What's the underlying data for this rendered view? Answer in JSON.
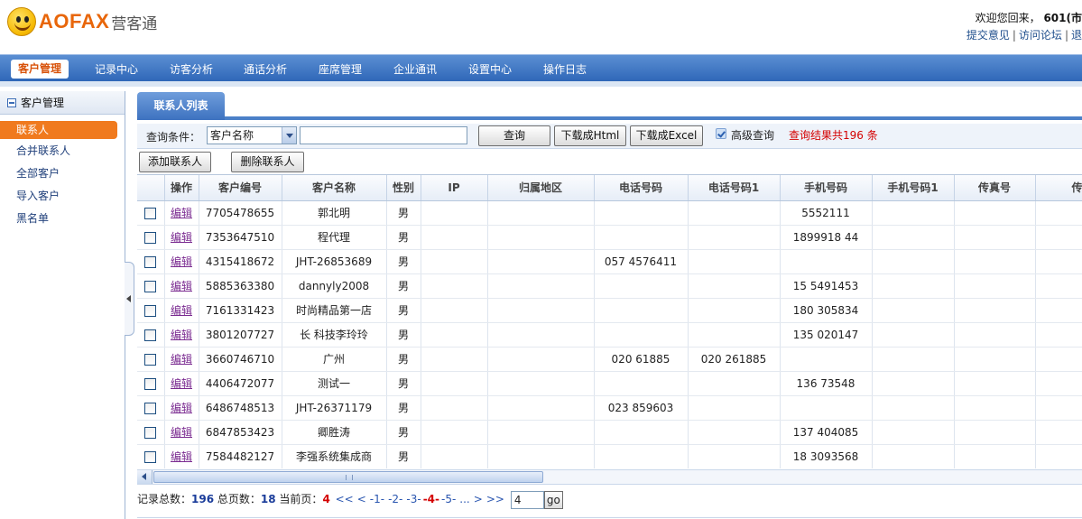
{
  "header": {
    "logo_text": "AOFAX",
    "logo_sub": "营客通",
    "welcome": "欢迎您回来，",
    "user": "601(市",
    "links": [
      "提交意见",
      "访问论坛",
      "退"
    ]
  },
  "nav": {
    "items": [
      "客户管理",
      "记录中心",
      "访客分析",
      "通话分析",
      "座席管理",
      "企业通讯",
      "设置中心",
      "操作日志"
    ],
    "active": "客户管理"
  },
  "sidebar": {
    "title": "客户管理",
    "items": [
      "联系人",
      "合并联系人",
      "全部客户",
      "导入客户",
      "黑名单"
    ]
  },
  "main": {
    "tab_label": "联系人列表",
    "query_label": "查询条件：",
    "query_field": "客户名称",
    "query_value": "",
    "query_button": "查询",
    "download_html": "下载成Html",
    "download_excel": "下载成Excel",
    "advanced_query": "高级查询",
    "result_prefix": "查询结果共",
    "result_count": "196",
    "result_suffix": " 条",
    "add_contact": "添加联系人",
    "delete_contact": "删除联系人"
  },
  "table": {
    "headers": [
      "操作",
      "客户编号",
      "客户名称",
      "性别",
      "IP",
      "归属地区",
      "电话号码",
      "电话号码1",
      "手机号码",
      "手机号码1",
      "传真号",
      "传真"
    ],
    "edit_label": "编辑",
    "rows": [
      {
        "id": "7705478655",
        "name": "郭北明",
        "gender": "男",
        "phone": "",
        "phone1": "",
        "mobile": "5552111"
      },
      {
        "id": "7353647510",
        "name": "程代理",
        "gender": "男",
        "phone": "",
        "phone1": "",
        "mobile": "1899918   44"
      },
      {
        "id": "4315418672",
        "name": "JHT-26853689",
        "gender": "男",
        "phone": "057   4576411",
        "phone1": "",
        "mobile": ""
      },
      {
        "id": "5885363380",
        "name": "dannyly2008",
        "gender": "男",
        "phone": "",
        "phone1": "",
        "mobile": "15   5491453"
      },
      {
        "id": "7161331423",
        "name": "时尚精品第一店",
        "gender": "男",
        "phone": "",
        "phone1": "",
        "mobile": "180   305834"
      },
      {
        "id": "3801207727",
        "name": "长   科技李玲玲",
        "gender": "男",
        "phone": "",
        "phone1": "",
        "mobile": "135   020147"
      },
      {
        "id": "3660746710",
        "name": "广州",
        "gender": "男",
        "phone": "020    61885",
        "phone1": "020   261885",
        "mobile": ""
      },
      {
        "id": "4406472077",
        "name": "测试一",
        "gender": "男",
        "phone": "",
        "phone1": "",
        "mobile": "136   73548"
      },
      {
        "id": "6486748513",
        "name": "JHT-26371179",
        "gender": "男",
        "phone": "023   859603",
        "phone1": "",
        "mobile": ""
      },
      {
        "id": "6847853423",
        "name": "卿胜涛",
        "gender": "男",
        "phone": "",
        "phone1": "",
        "mobile": "137   404085"
      },
      {
        "id": "7584482127",
        "name": "李强系统集成商",
        "gender": "男",
        "phone": "",
        "phone1": "",
        "mobile": "18   3093568"
      }
    ]
  },
  "pager": {
    "total_label": "记录总数：",
    "total": "196",
    "pages_label": " 总页数：",
    "pages": "18",
    "current_label": " 当前页：",
    "current": "4",
    "first": "<<",
    "prev": "<",
    "page_links": [
      "-1-",
      "-2-",
      "-3-"
    ],
    "current_link": "-4-",
    "page_link_after": "-5-",
    "ellipsis": "...",
    "next": ">",
    "last": ">>",
    "goto_value": "4",
    "go_label": "go"
  }
}
